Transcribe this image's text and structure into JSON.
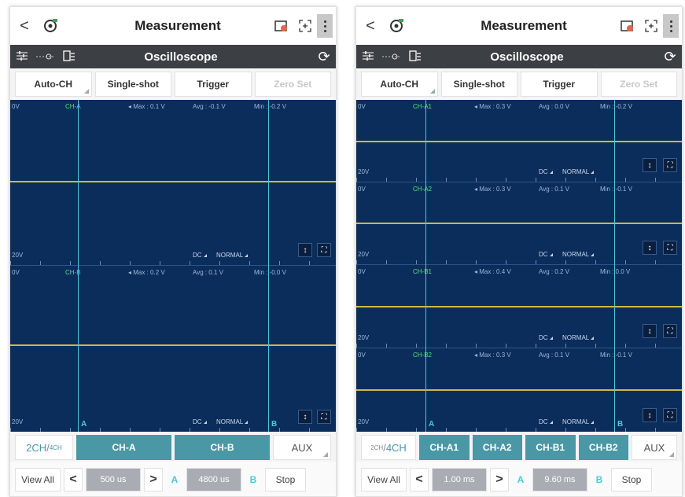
{
  "colors": {
    "scope_bg": "#0b2d5c",
    "trace": "#d8c23a",
    "accent": "#4a98a6",
    "cursor": "#4ec7d9",
    "channel_label": "#4fe07c"
  },
  "icons": {
    "back": "chevron-left-icon",
    "logo": "vehicle-gear-icon",
    "battery": "battery-icon",
    "focus": "focus-icon",
    "menu": "more-vertical-icon",
    "settings": "sliders-icon",
    "probe": "probe-icon",
    "save": "save-icon",
    "refresh": "refresh-icon",
    "up_down": "up-down-arrows-icon",
    "expand": "expand-icon"
  },
  "phones": [
    {
      "top": {
        "back": "<",
        "title": "Measurement"
      },
      "sub": {
        "title": "Oscilloscope"
      },
      "buttons": [
        "Auto-CH",
        "Single-shot",
        "Trigger",
        "Zero Set"
      ],
      "channels": [
        {
          "top_left": "0V",
          "name": "CH-A",
          "max": "◂ Max : 0.1 V",
          "avg": "Avg : -0.1 V",
          "min": "Min : -0.2 V",
          "bottom_left": "20V",
          "coupling": "DC",
          "mode": "NORMAL"
        },
        {
          "top_left": "0V",
          "name": "CH-B",
          "max": "◂ Max : 0.2 V",
          "avg": "Avg : 0.1 V",
          "min": "Min : -0.0 V",
          "bottom_left": "20V",
          "coupling": "DC",
          "mode": "NORMAL"
        }
      ],
      "cursor_a": "A",
      "cursor_b": "B",
      "mode_big": "2CH",
      "mode_small": "4CH",
      "ch_buttons": [
        "CH-A",
        "CH-B"
      ],
      "aux": "AUX",
      "bottom": {
        "view_all": "View All",
        "left": "<",
        "time": "500 us",
        "right": ">",
        "a": "A",
        "cursor_time": "4800 us",
        "b": "B",
        "stop": "Stop"
      }
    },
    {
      "top": {
        "back": "<",
        "title": "Measurement"
      },
      "sub": {
        "title": "Oscilloscope"
      },
      "buttons": [
        "Auto-CH",
        "Single-shot",
        "Trigger",
        "Zero Set"
      ],
      "channels": [
        {
          "top_left": "0V",
          "name": "CH-A1",
          "max": "◂ Max : 0.3 V",
          "avg": "Avg : 0.0 V",
          "min": "Min : -0.2 V",
          "bottom_left": "20V",
          "coupling": "DC",
          "mode": "NORMAL"
        },
        {
          "top_left": "0V",
          "name": "CH-A2",
          "max": "◂ Max : 0.3 V",
          "avg": "Avg : 0.1 V",
          "min": "Min : -0.1 V",
          "bottom_left": "20V",
          "coupling": "DC",
          "mode": "NORMAL"
        },
        {
          "top_left": "0V",
          "name": "CH-B1",
          "max": "◂ Max : 0.4 V",
          "avg": "Avg : 0.2 V",
          "min": "Min : 0.0 V",
          "bottom_left": "20V",
          "coupling": "DC",
          "mode": "NORMAL"
        },
        {
          "top_left": "0V",
          "name": "CH-B2",
          "max": "◂ Max : 0.3 V",
          "avg": "Avg : 0.1 V",
          "min": "Min : -0.1 V",
          "bottom_left": "20V",
          "coupling": "DC",
          "mode": "NORMAL"
        }
      ],
      "cursor_a": "A",
      "cursor_b": "B",
      "mode_big": "4CH",
      "mode_small": "2CH",
      "ch_buttons": [
        "CH-A1",
        "CH-A2",
        "CH-B1",
        "CH-B2"
      ],
      "aux": "AUX",
      "bottom": {
        "view_all": "View All",
        "left": "<",
        "time": "1.00 ms",
        "right": ">",
        "a": "A",
        "cursor_time": "9.60 ms",
        "b": "B",
        "stop": "Stop"
      }
    }
  ]
}
